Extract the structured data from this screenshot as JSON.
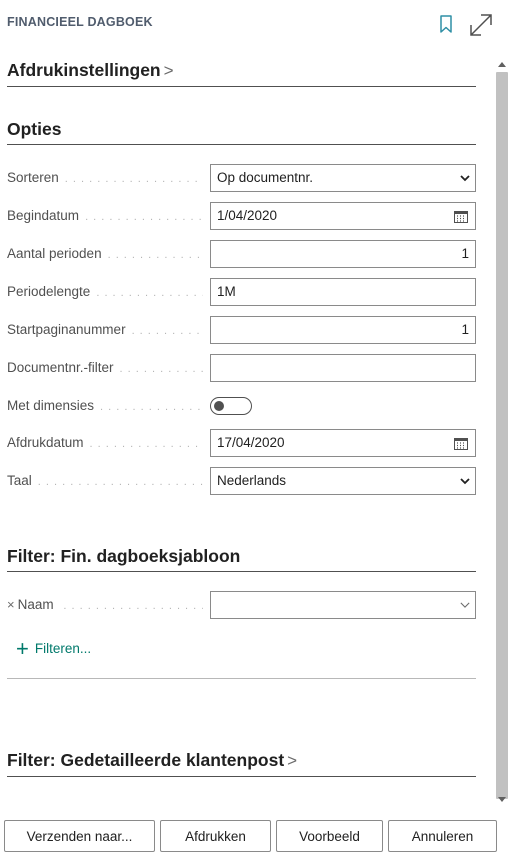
{
  "header": {
    "title": "FINANCIEEL DAGBOEK",
    "bookmark_icon": "bookmark-icon",
    "expand_icon": "expand-icon"
  },
  "sections": {
    "print_settings": {
      "title": "Afdrukinstellingen",
      "chevron": ">"
    },
    "options": {
      "title": "Opties"
    },
    "filter_template": {
      "title": "Filter: Fin. dagboeksjabloon"
    },
    "filter_customer": {
      "title": "Filter: Gedetailleerde klantenpost",
      "chevron": ">"
    }
  },
  "options": {
    "sort": {
      "label": "Sorteren",
      "value": "Op documentnr."
    },
    "start_date": {
      "label": "Begindatum",
      "value": "1/04/2020"
    },
    "periods": {
      "label": "Aantal perioden",
      "value": "1"
    },
    "period_length": {
      "label": "Periodelengte",
      "value": "1M"
    },
    "start_page": {
      "label": "Startpaginanummer",
      "value": "1"
    },
    "doc_filter": {
      "label": "Documentnr.-filter",
      "value": ""
    },
    "dimensions": {
      "label": "Met dimensies",
      "on": false
    },
    "print_date": {
      "label": "Afdrukdatum",
      "value": "17/04/2020"
    },
    "language": {
      "label": "Taal",
      "value": "Nederlands"
    }
  },
  "filter_template": {
    "name_field": {
      "remove_glyph": "×",
      "label": "Naam",
      "value": ""
    },
    "add_filter": {
      "plus": "+",
      "label": "Filteren..."
    }
  },
  "footer": {
    "send_to": "Verzenden naar...",
    "print": "Afdrukken",
    "preview": "Voorbeeld",
    "cancel": "Annuleren"
  },
  "colors": {
    "accent": "#00796b",
    "bookmark": "#2f8fa5",
    "border": "#8a8a8a",
    "text": "#212121",
    "label": "#505050"
  }
}
